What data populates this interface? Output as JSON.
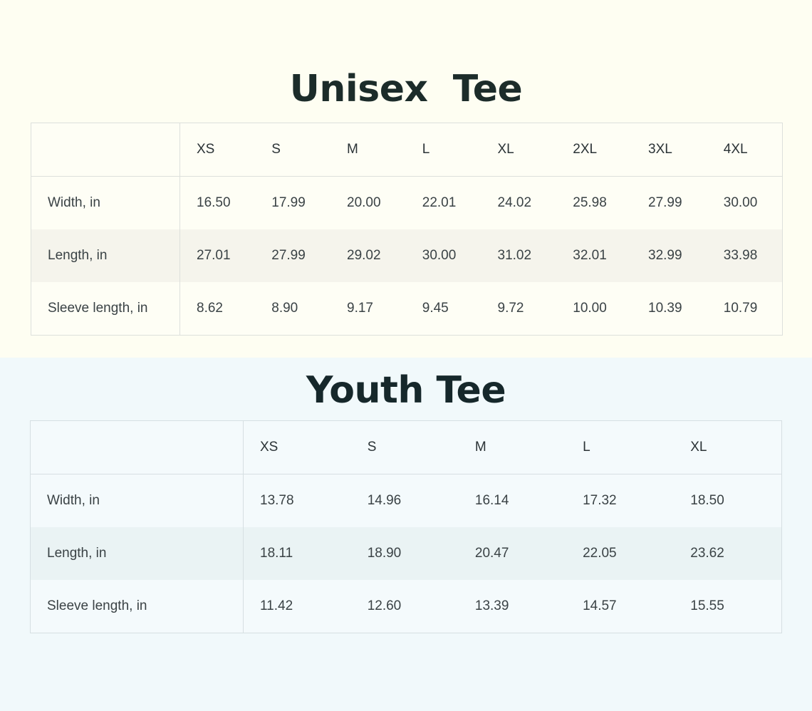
{
  "unisex": {
    "title": "Unisex  Tee",
    "sizes": [
      "XS",
      "S",
      "M",
      "L",
      "XL",
      "2XL",
      "3XL",
      "4XL"
    ],
    "rows": [
      {
        "label": "Width, in",
        "values": [
          "16.50",
          "17.99",
          "20.00",
          "22.01",
          "24.02",
          "25.98",
          "27.99",
          "30.00"
        ]
      },
      {
        "label": "Length, in",
        "values": [
          "27.01",
          "27.99",
          "29.02",
          "30.00",
          "31.02",
          "32.01",
          "32.99",
          "33.98"
        ]
      },
      {
        "label": "Sleeve length, in",
        "values": [
          "8.62",
          "8.90",
          "9.17",
          "9.45",
          "9.72",
          "10.00",
          "10.39",
          "10.79"
        ]
      }
    ]
  },
  "youth": {
    "title": "Youth Tee",
    "sizes": [
      "XS",
      "S",
      "M",
      "L",
      "XL"
    ],
    "rows": [
      {
        "label": "Width, in",
        "values": [
          "13.78",
          "14.96",
          "16.14",
          "17.32",
          "18.50"
        ]
      },
      {
        "label": "Length, in",
        "values": [
          "18.11",
          "18.90",
          "20.47",
          "22.05",
          "23.62"
        ]
      },
      {
        "label": "Sleeve length, in",
        "values": [
          "11.42",
          "12.60",
          "13.39",
          "14.57",
          "15.55"
        ]
      }
    ]
  },
  "colors": {
    "unisex_background": "#fefef2",
    "youth_background": "#f1f9fb",
    "unisex_stripe": "#f5f4ec",
    "youth_stripe": "#eaf3f4",
    "title_text": "#1c2c2a"
  }
}
